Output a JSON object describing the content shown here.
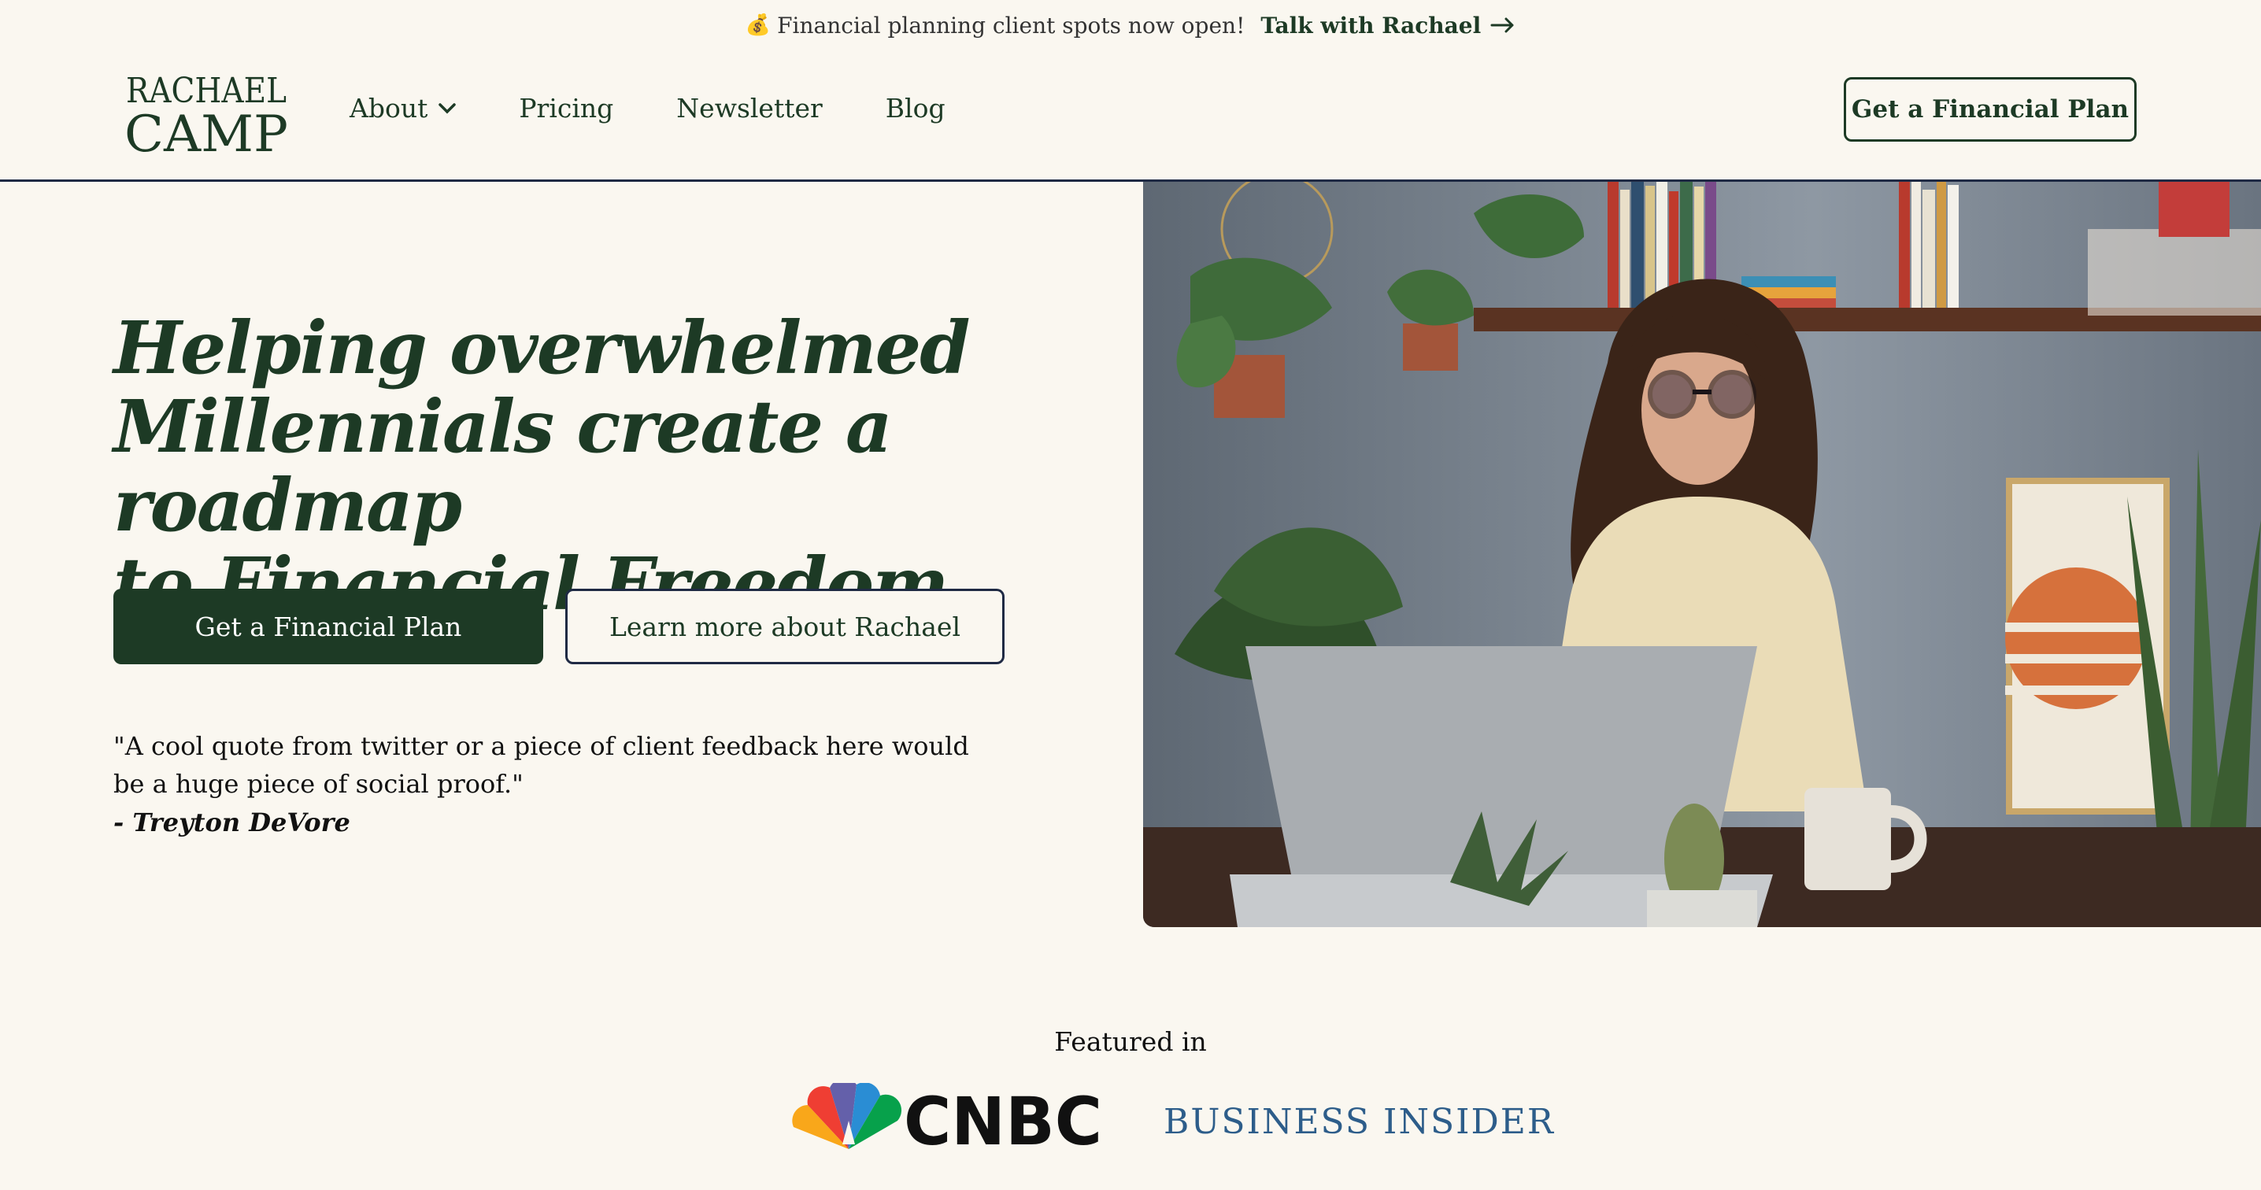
{
  "announcement": {
    "icon": "money-bag-icon",
    "emoji": "💰",
    "text": "Financial planning client spots now open!",
    "link_label": "Talk with Rachael"
  },
  "logo": {
    "line1": "RACHAEL",
    "line2": "CAMP"
  },
  "nav": {
    "items": [
      {
        "label": "About",
        "has_dropdown": true
      },
      {
        "label": "Pricing"
      },
      {
        "label": "Newsletter"
      },
      {
        "label": "Blog"
      }
    ],
    "cta_label": "Get a Financial Plan"
  },
  "hero": {
    "headline_line1": "Helping overwhelmed",
    "headline_line2": "Millennials create a roadmap",
    "headline_line3": "to Financial Freedom",
    "primary_button": "Get a Financial Plan",
    "secondary_button": "Learn more about Rachael",
    "quote": "\"A cool quote from twitter or a piece of client feedback here would be a huge piece of social proof.\"",
    "quote_author": "- Treyton DeVore"
  },
  "featured": {
    "label": "Featured in",
    "logos": [
      {
        "name": "CNBC",
        "text": "CNBC"
      },
      {
        "name": "Business Insider",
        "text": "BUSINESS INSIDER"
      }
    ]
  },
  "colors": {
    "background": "#faf7f0",
    "brand_green": "#1d3a25",
    "navy_border": "#1f2a44",
    "business_insider_blue": "#2d5d8a"
  }
}
